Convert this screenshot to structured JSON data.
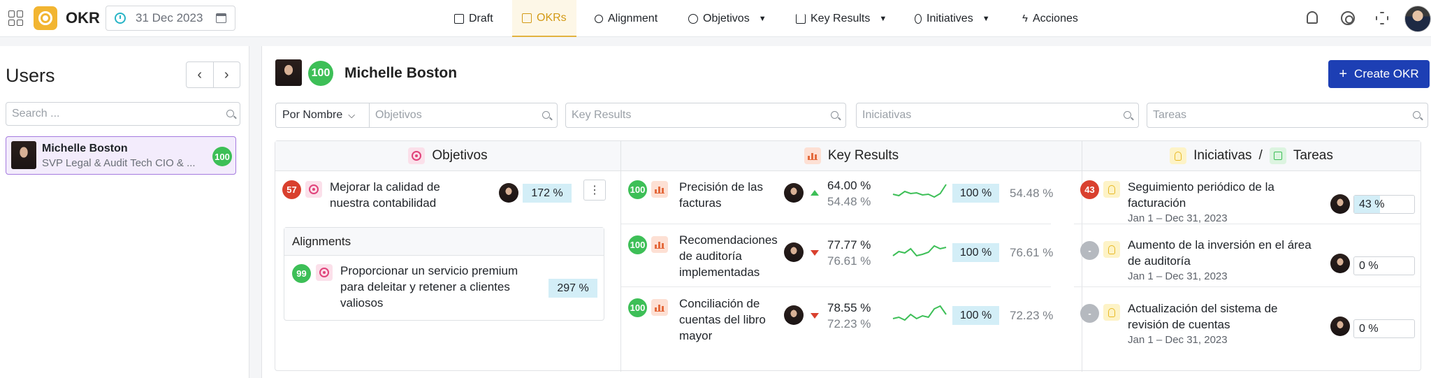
{
  "app": {
    "title": "OKR",
    "date": "31 Dec 2023"
  },
  "nav": {
    "items": [
      {
        "label": "Draft",
        "icon": "book-icon"
      },
      {
        "label": "OKRs",
        "icon": "board-icon"
      },
      {
        "label": "Alignment",
        "icon": "link-icon"
      },
      {
        "label": "Objetivos",
        "icon": "target-icon"
      },
      {
        "label": "Key Results",
        "icon": "bar-chart-icon"
      },
      {
        "label": "Initiatives",
        "icon": "bulb-icon"
      },
      {
        "label": "Acciones",
        "icon": "bolt-icon"
      }
    ],
    "active": "OKRs"
  },
  "users": {
    "title": "Users",
    "search_placeholder": "Search ...",
    "selected": {
      "name": "Michelle Boston",
      "role": "SVP Legal & Audit Tech CIO & ...",
      "score": "100"
    }
  },
  "main": {
    "person_name": "Michelle Boston",
    "person_score": "100",
    "create_label": "Create OKR",
    "sort_label": "Por Nombre",
    "filters": {
      "objetivos": "Objetivos",
      "key_results": "Key Results",
      "iniciativas": "Iniciativas",
      "tareas": "Tareas"
    },
    "headers": {
      "objetivos": "Objetivos",
      "key_results": "Key Results",
      "iniciativas": "Iniciativas",
      "separator": "/",
      "tareas": "Tareas"
    }
  },
  "objective": {
    "score": "57",
    "text_line1": "Mejorar la calidad de",
    "text_line2": "nuestra contabilidad",
    "percent": "172 %",
    "kebab": "⋮",
    "alignments_title": "Alignments",
    "alignment": {
      "score": "99",
      "line1": "Proporcionar un servicio premium",
      "line2": "para deleitar y retener a clientes",
      "line3": "valiosos",
      "percent": "297 %"
    }
  },
  "key_results": [
    {
      "score": "100",
      "lines": [
        "Precisión de las",
        "facturas"
      ],
      "value": "64.00 %",
      "prev": "54.48 %",
      "trend": "up",
      "pill": "100 %",
      "end": "54.48 %",
      "spark": [
        18,
        20,
        14,
        17,
        16,
        19,
        18,
        22,
        17,
        4
      ]
    },
    {
      "score": "100",
      "lines": [
        "Recomendaciones",
        "de auditoría",
        "implementadas"
      ],
      "value": "77.77 %",
      "prev": "76.61 %",
      "trend": "down",
      "pill": "100 %",
      "end": "76.61 %",
      "spark": [
        22,
        16,
        18,
        12,
        22,
        20,
        17,
        8,
        12,
        10
      ]
    },
    {
      "score": "100",
      "lines": [
        "Conciliación de",
        "cuentas del libro",
        "mayor"
      ],
      "value": "78.55 %",
      "prev": "72.23 %",
      "trend": "down",
      "pill": "100 %",
      "end": "72.23 %",
      "spark": [
        22,
        20,
        24,
        16,
        22,
        18,
        20,
        8,
        4,
        16
      ]
    }
  ],
  "initiatives": [
    {
      "score": "43",
      "score_color": "red",
      "lines": [
        "Seguimiento periódico de la",
        "facturación"
      ],
      "dates": "Jan 1 – Dec 31, 2023",
      "percent": "43 %",
      "progress": 0.43
    },
    {
      "score": "-",
      "score_color": "gray",
      "lines": [
        "Aumento de la inversión en el área",
        "de auditoría"
      ],
      "dates": "Jan 1 – Dec 31, 2023",
      "percent": "0 %",
      "progress": 0
    },
    {
      "score": "-",
      "score_color": "gray",
      "lines": [
        "Actualización del sistema de",
        "revisión de cuentas"
      ],
      "dates": "Jan 1 – Dec 31, 2023",
      "percent": "0 %",
      "progress": 0
    }
  ],
  "colors": {
    "accent": "#d39a16",
    "primary_button": "#1d3fb4",
    "green": "#3dbf57",
    "red": "#d9402e",
    "pill": "#d3eef7"
  }
}
